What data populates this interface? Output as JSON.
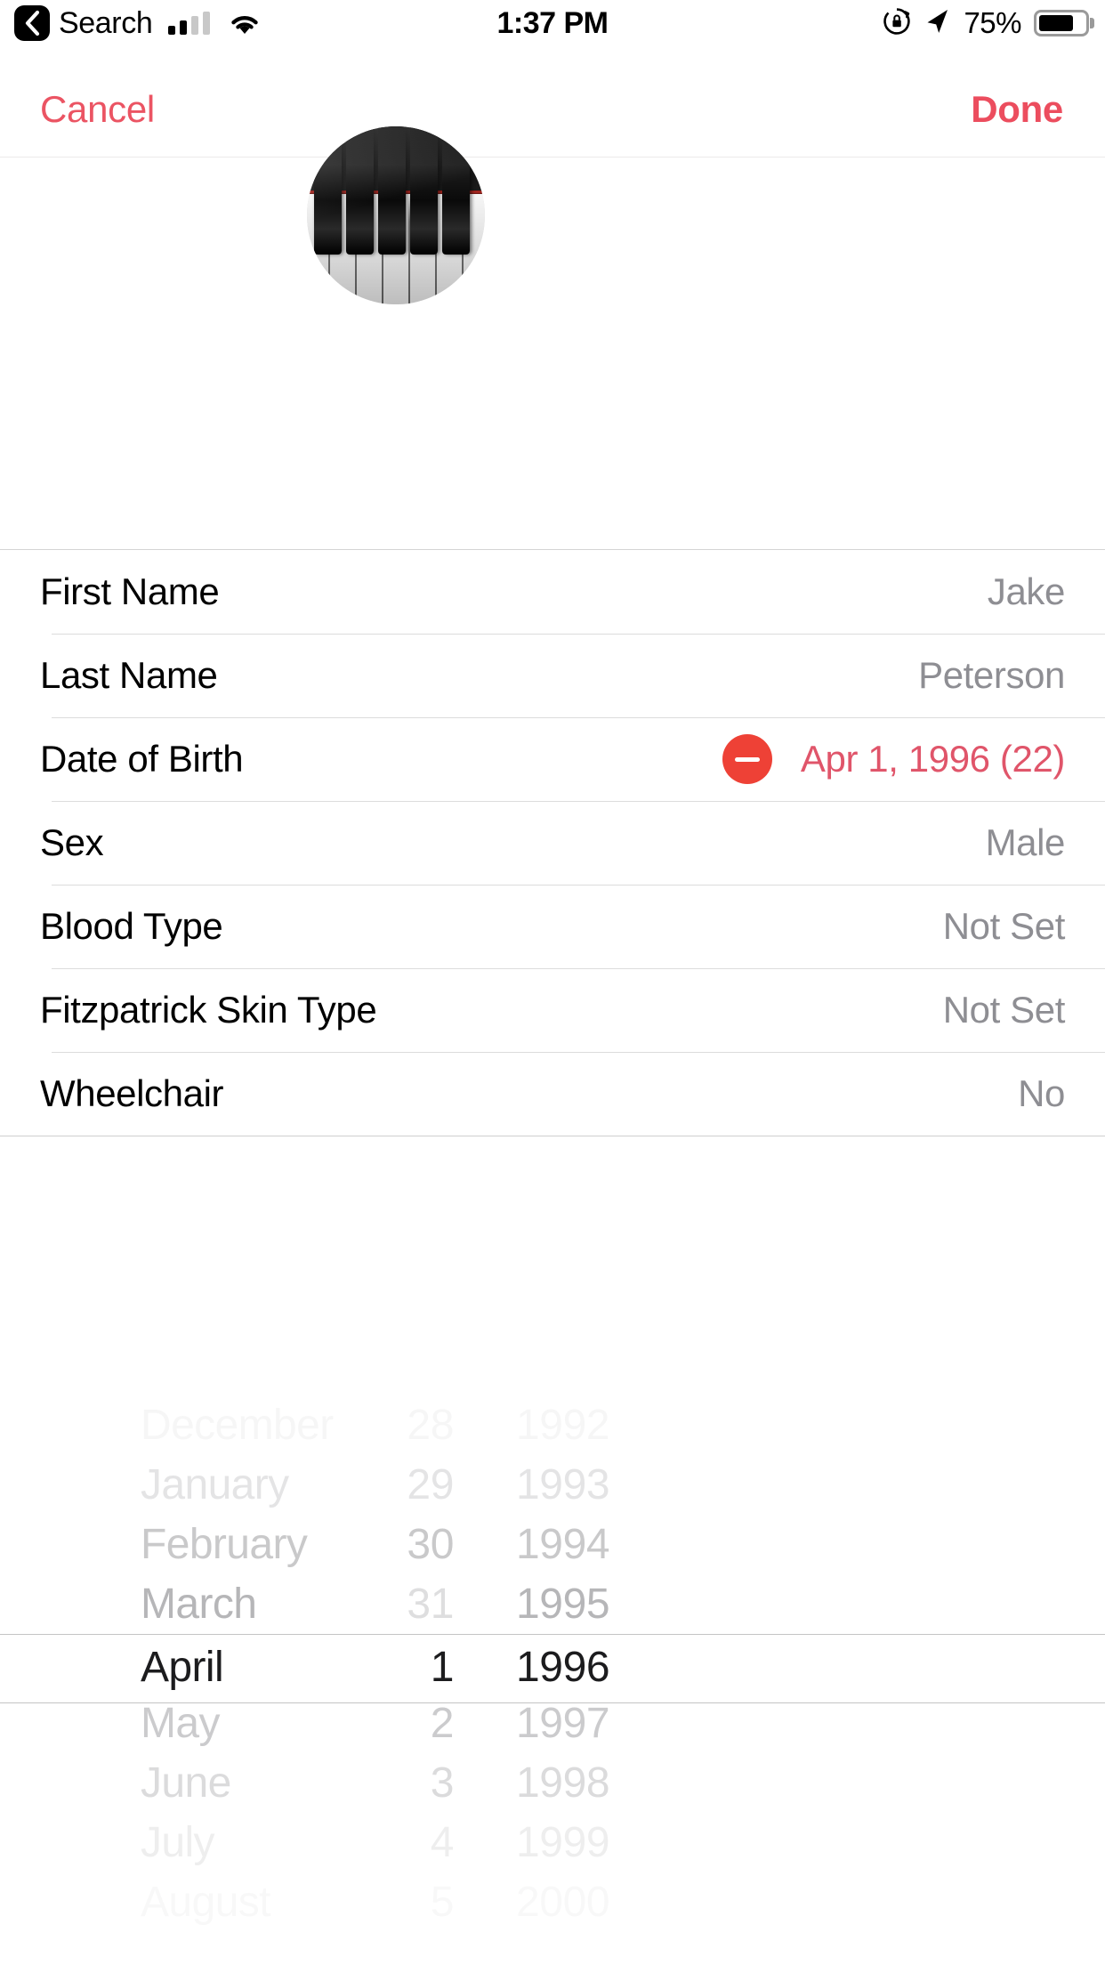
{
  "status_bar": {
    "back_icon": "back-chevron-icon",
    "carrier_label": "Search",
    "signal_icon": "cellular-signal-icon",
    "wifi_icon": "wifi-icon",
    "time": "1:37 PM",
    "rotation_lock_icon": "rotation-lock-icon",
    "location_icon": "location-arrow-icon",
    "battery_percent": "75%",
    "battery_icon": "battery-icon",
    "battery_level": 75
  },
  "nav_bar": {
    "cancel_label": "Cancel",
    "done_label": "Done"
  },
  "avatar": {
    "name": "profile-photo",
    "description": "piano-keyboard-photo"
  },
  "form": {
    "rows": [
      {
        "label": "First Name",
        "value": "Jake",
        "name": "first-name"
      },
      {
        "label": "Last Name",
        "value": "Peterson",
        "name": "last-name"
      },
      {
        "label": "Date of Birth",
        "value": "Apr 1, 1996 (22)",
        "name": "date-of-birth",
        "accent": true,
        "has_delete": true
      },
      {
        "label": "Sex",
        "value": "Male",
        "name": "sex"
      },
      {
        "label": "Blood Type",
        "value": "Not Set",
        "name": "blood-type"
      },
      {
        "label": "Fitzpatrick Skin Type",
        "value": "Not Set",
        "name": "fitzpatrick-skin-type"
      },
      {
        "label": "Wheelchair",
        "value": "No",
        "name": "wheelchair"
      }
    ]
  },
  "date_picker": {
    "selected": {
      "month": "April",
      "day": "1",
      "year": "1996"
    },
    "rows": [
      {
        "month": "December",
        "day": "28",
        "year": "1992",
        "opacity": 0.07,
        "day_disabled": false
      },
      {
        "month": "January",
        "day": "29",
        "year": "1993",
        "opacity": 0.22,
        "day_disabled": false
      },
      {
        "month": "February",
        "day": "30",
        "year": "1994",
        "opacity": 0.46,
        "day_disabled": false
      },
      {
        "month": "March",
        "day": "31",
        "year": "1995",
        "opacity": 0.62,
        "day_disabled": true
      },
      {
        "month": "April",
        "day": "1",
        "year": "1996",
        "opacity": 1.0,
        "day_disabled": false,
        "selected": true
      },
      {
        "month": "May",
        "day": "2",
        "year": "1997",
        "opacity": 0.44,
        "day_disabled": false
      },
      {
        "month": "June",
        "day": "3",
        "year": "1998",
        "opacity": 0.3,
        "day_disabled": false
      },
      {
        "month": "July",
        "day": "4",
        "year": "1999",
        "opacity": 0.14,
        "day_disabled": false
      },
      {
        "month": "August",
        "day": "5",
        "year": "2000",
        "opacity": 0.05,
        "day_disabled": false
      }
    ]
  },
  "colors": {
    "tint": "#EB5463",
    "delete_red": "#EE4136",
    "value_gray": "#8e8e93",
    "separator": "#dcdcdc"
  }
}
